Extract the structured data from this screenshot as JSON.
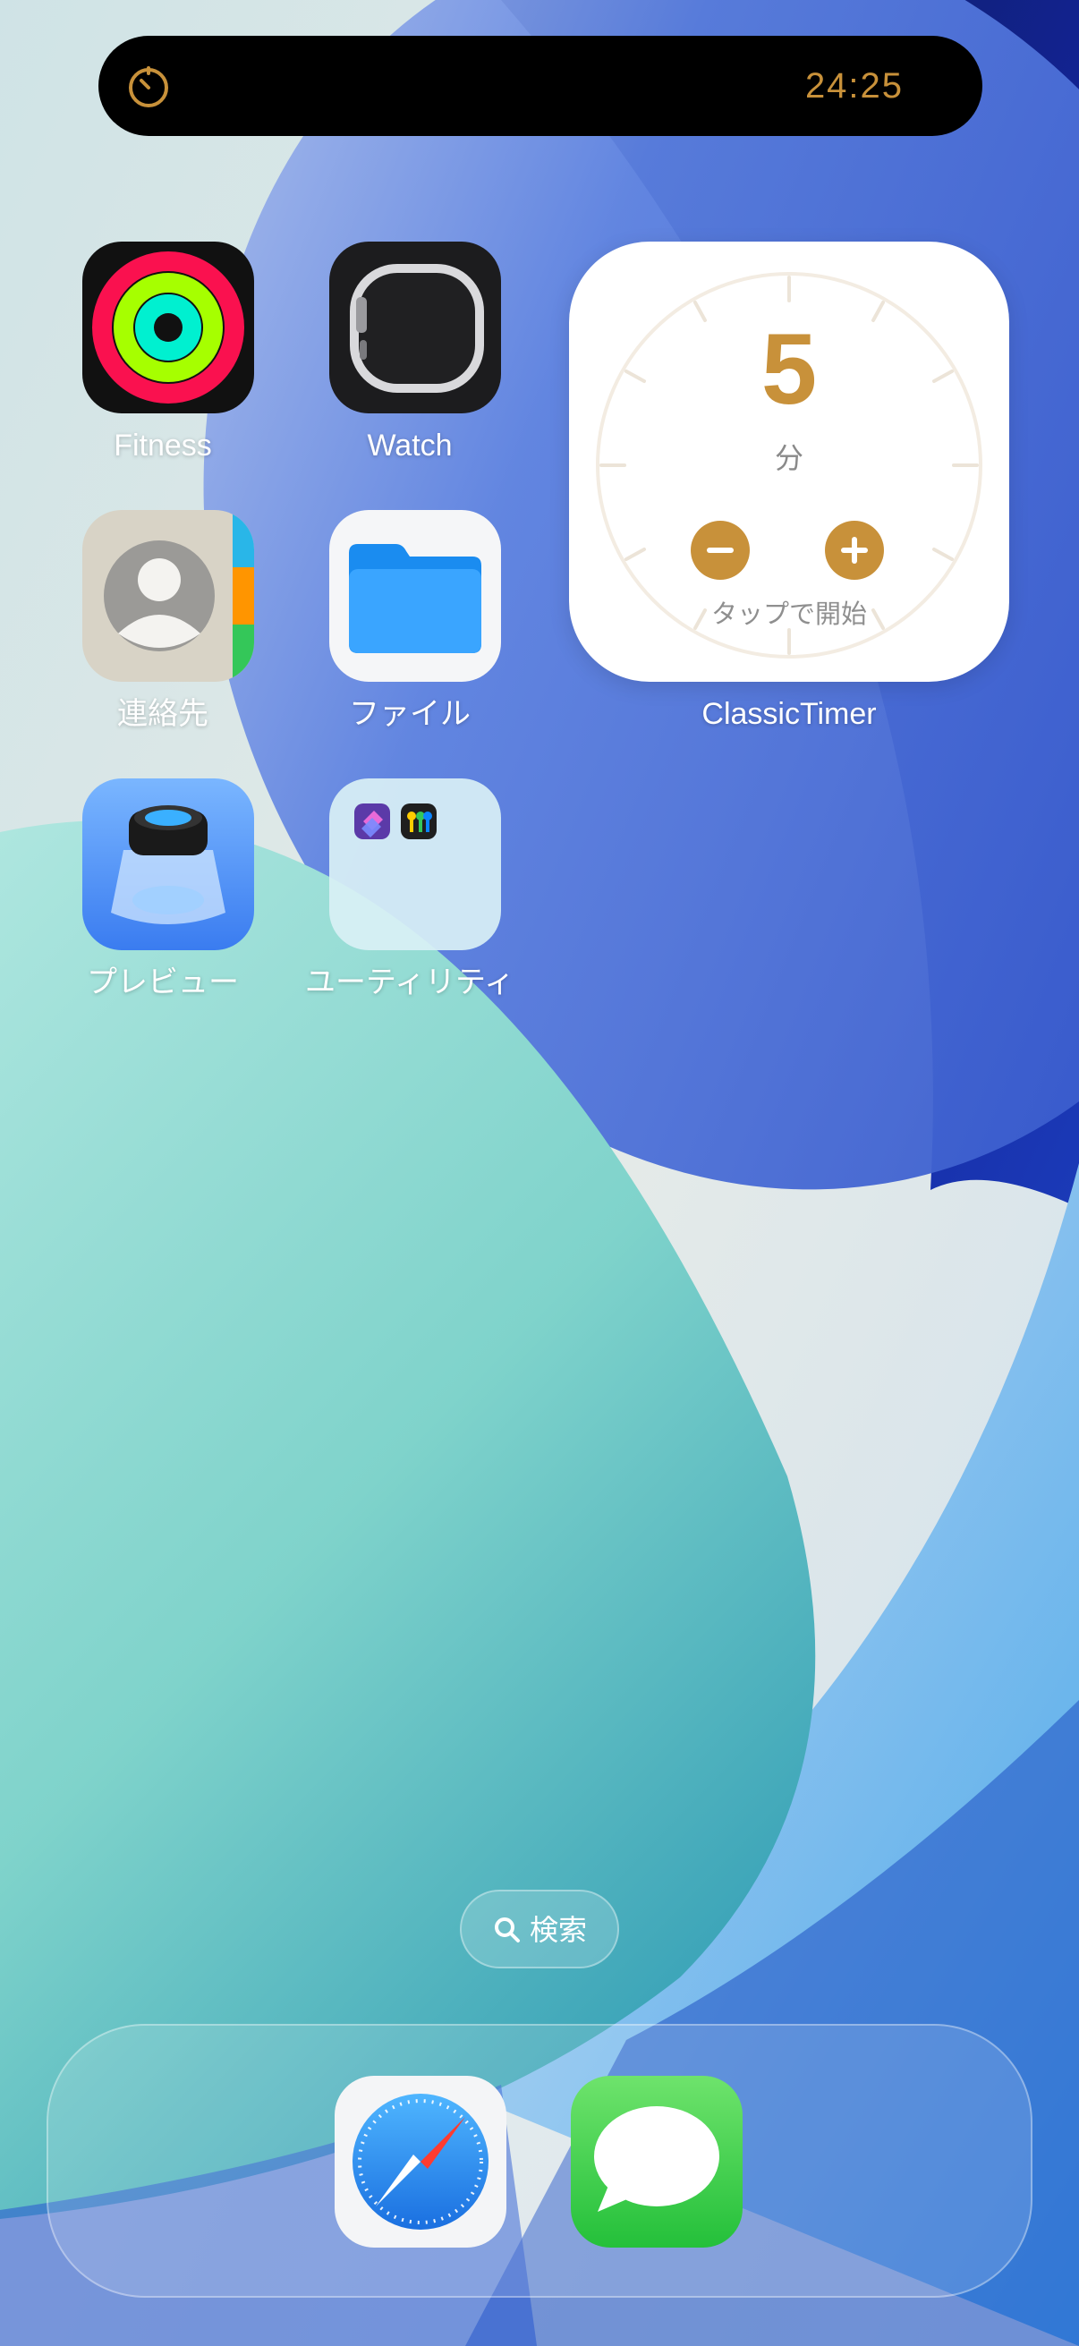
{
  "live_activity": {
    "icon": "timer-icon",
    "time": "24:25",
    "accent": "#c8913a"
  },
  "apps": [
    {
      "label": "Fitness",
      "icon": "fitness-rings-icon"
    },
    {
      "label": "Watch",
      "icon": "watch-icon"
    },
    {
      "label": "連絡先",
      "icon": "contacts-icon"
    },
    {
      "label": "ファイル",
      "icon": "files-folder-icon"
    },
    {
      "label": "プレビュー",
      "icon": "preview-loupe-icon"
    },
    {
      "label": "ユーティリティ",
      "icon": "utilities-folder-icon"
    }
  ],
  "widget": {
    "minutes": "5",
    "unit": "分",
    "hint": "タップで開始",
    "label": "ClassicTimer",
    "accent": "#c8913a"
  },
  "search": {
    "label": "検索",
    "icon": "search-icon"
  },
  "dock": [
    {
      "icon": "safari-compass-icon"
    },
    {
      "icon": "messages-bubble-icon"
    }
  ]
}
